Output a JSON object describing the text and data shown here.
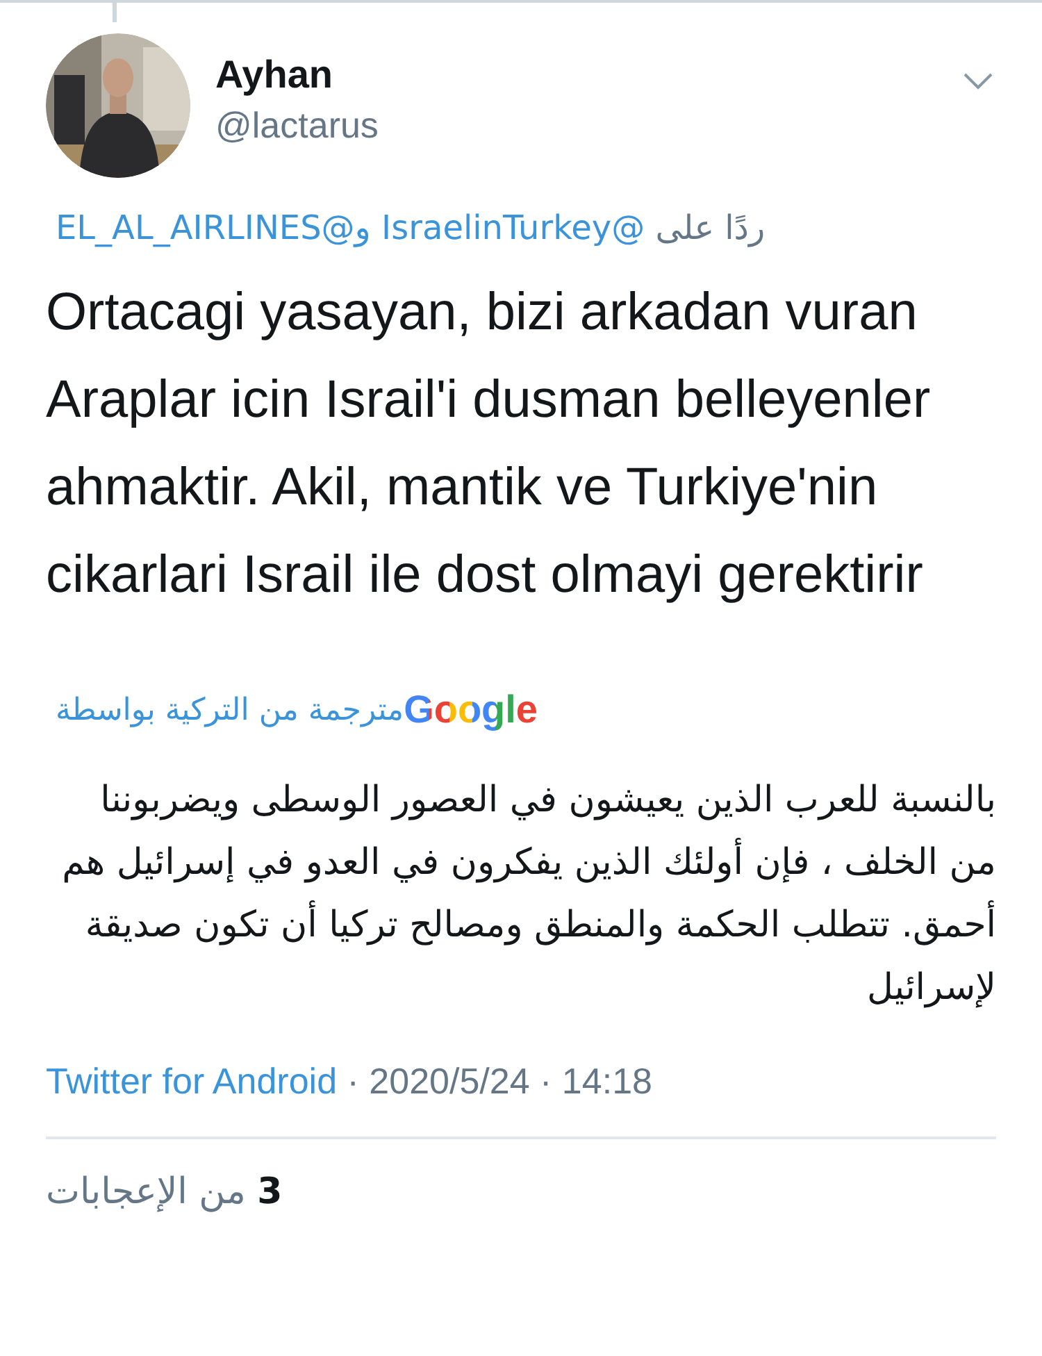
{
  "tweet": {
    "author": {
      "name": "Ayhan",
      "handle": "@lactarus"
    },
    "reply_to": {
      "prefix": "ردًا على",
      "mentions": [
        "@IsraelinTurkey",
        "و@EL_AL_AIRLINES"
      ]
    },
    "text": "Ortacagi yasayan, bizi arkadan vuran Araplar icin Israil'i dusman belleyenler ahmaktir. Akil, mantik ve Turkiye'nin cikarlari Israil ile dost olmayi gerektirir",
    "translation_label": "مترجمة من التركية بواسطة",
    "translation_provider": "Google",
    "translation": "بالنسبة للعرب الذين يعيشون في العصور الوسطى ويضربوننا من الخلف ، فإن أولئك الذين يفكرون في العدو في إسرائيل هم أحمق. تتطلب الحكمة والمنطق ومصالح تركيا أن تكون صديقة لإسرائيل",
    "source": "Twitter for Android",
    "date": "· 2020/5/24 · 14:18",
    "likes": "**3** من الإعجابات"
  }
}
